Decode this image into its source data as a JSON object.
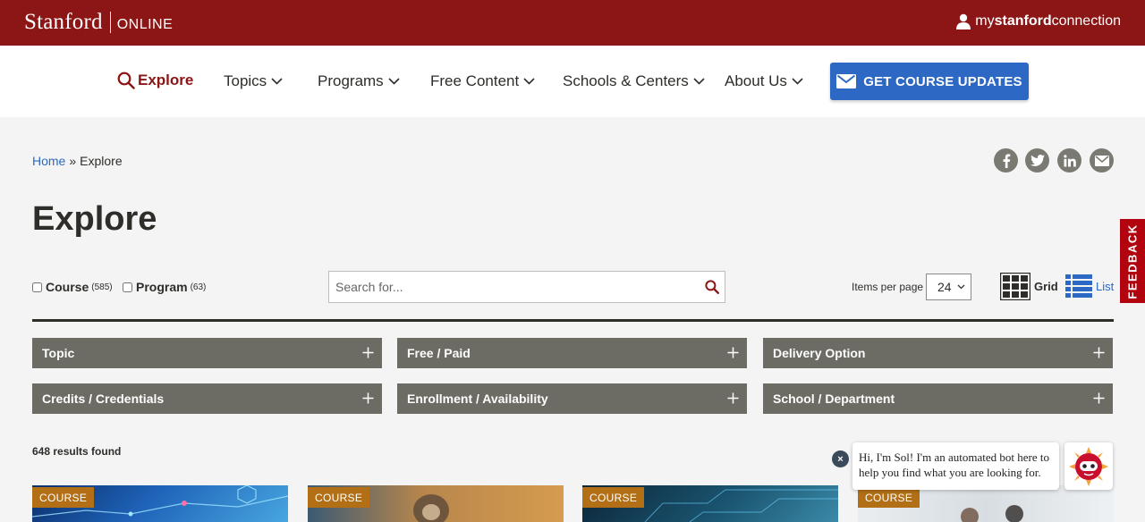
{
  "header": {
    "brand_stanford": "Stanford",
    "brand_online": "ONLINE",
    "account_link_prefix": "my",
    "account_link_bold": "stanford",
    "account_link_suffix": "connection"
  },
  "nav": {
    "explore": "Explore",
    "items": [
      {
        "label": "Topics"
      },
      {
        "label": "Programs"
      },
      {
        "label": "Free Content"
      },
      {
        "label": "Schools & Centers"
      },
      {
        "label": "About Us"
      }
    ],
    "cta": "GET COURSE UPDATES"
  },
  "breadcrumb": {
    "home": "Home",
    "separator": "»",
    "current": "Explore"
  },
  "share": {
    "icons": [
      "facebook-icon",
      "twitter-icon",
      "linkedin-icon",
      "email-icon"
    ]
  },
  "page_title": "Explore",
  "filters": {
    "course_label": "Course",
    "course_count": "(585)",
    "program_label": "Program",
    "program_count": "(63)",
    "search_placeholder": "Search for...",
    "items_per_page_label": "Items per page",
    "items_per_page_value": "24",
    "view_grid": "Grid",
    "view_list": "List"
  },
  "facets": {
    "topic": "Topic",
    "free_paid": "Free / Paid",
    "delivery": "Delivery Option",
    "credits": "Credits / Credentials",
    "enrollment": "Enrollment / Availability",
    "school": "School / Department"
  },
  "results_text": "648 results found",
  "cards": [
    {
      "badge": "COURSE",
      "color": "#1a4f9a"
    },
    {
      "badge": "COURSE",
      "color": "#c98a3c"
    },
    {
      "badge": "COURSE",
      "color": "#143d55"
    },
    {
      "badge": "COURSE",
      "color": "#dde3e6"
    }
  ],
  "feedback": "FEEDBACK",
  "chatbot": {
    "message": "Hi, I'm Sol! I'm an automated bot here to help you find what you are looking for.",
    "close": "×"
  },
  "colors": {
    "cardinal": "#8c1515",
    "link_blue": "#2d68c4",
    "facet_gray": "#6d6c64",
    "badge_orange": "#b26f16"
  }
}
